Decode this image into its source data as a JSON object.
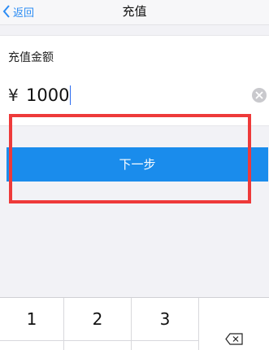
{
  "nav": {
    "back_label": "返回",
    "title": "充值"
  },
  "recharge": {
    "label": "充值金额",
    "currency_symbol": "¥",
    "amount_value": "1000"
  },
  "next_button_label": "下一步",
  "keypad": {
    "keys": [
      "1",
      "2",
      "3"
    ],
    "delete_icon": "backspace-icon"
  },
  "colors": {
    "accent": "#1a8cec",
    "link": "#2c8cf4",
    "highlight": "#ee3a3a",
    "background": "#f2f2f6"
  }
}
